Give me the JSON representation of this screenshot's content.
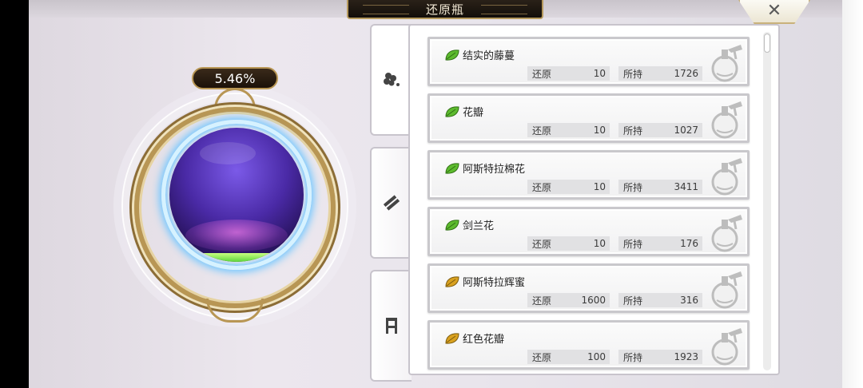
{
  "header": {
    "title": "还原瓶"
  },
  "orb": {
    "percent_label": "5.46%",
    "fill_fraction": 0.0546,
    "liquid_color": "#5cd43a"
  },
  "tabs": [
    {
      "icon": "flower-icon",
      "active": true
    },
    {
      "icon": "wood-plank-icon",
      "active": false
    },
    {
      "icon": "chair-icon",
      "active": false
    }
  ],
  "items": [
    {
      "name": "结实的藤蔓",
      "restore_label": "还原",
      "restore_value": "10",
      "owned_label": "所持",
      "owned_value": "1726",
      "leaf_color": "#5dbb2e"
    },
    {
      "name": "花瓣",
      "restore_label": "还原",
      "restore_value": "10",
      "owned_label": "所持",
      "owned_value": "1027",
      "leaf_color": "#5dbb2e"
    },
    {
      "name": "阿斯特拉棉花",
      "restore_label": "还原",
      "restore_value": "10",
      "owned_label": "所持",
      "owned_value": "3411",
      "leaf_color": "#5dbb2e"
    },
    {
      "name": "剑兰花",
      "restore_label": "还原",
      "restore_value": "10",
      "owned_label": "所持",
      "owned_value": "176",
      "leaf_color": "#5dbb2e"
    },
    {
      "name": "阿斯特拉辉蜜",
      "restore_label": "还原",
      "restore_value": "1600",
      "owned_label": "所持",
      "owned_value": "316",
      "leaf_color": "#d9a11f"
    },
    {
      "name": "红色花瓣",
      "restore_label": "还原",
      "restore_value": "100",
      "owned_label": "所持",
      "owned_value": "1923",
      "leaf_color": "#d9a11f"
    }
  ],
  "colors": {
    "frame_gold": "#b89654",
    "orb_purple": "#4a2aa6",
    "ring_blue": "#6fc6ff"
  }
}
